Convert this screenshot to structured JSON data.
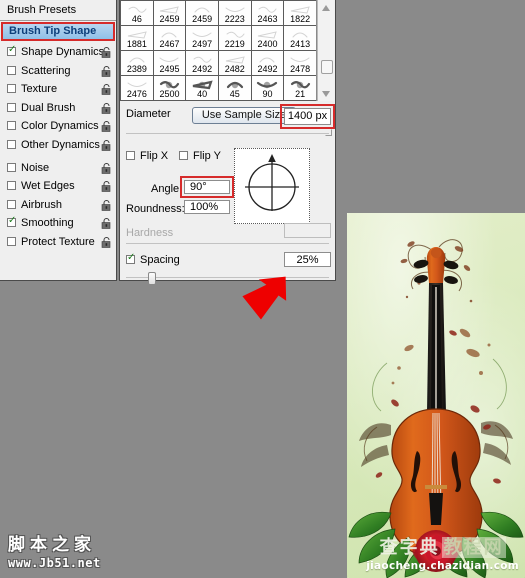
{
  "left_panel": {
    "header": "Brush Presets",
    "selected_item": "Brush Tip Shape",
    "items": [
      {
        "label": "Shape Dynamics",
        "checked": true,
        "locked": true,
        "gap": false
      },
      {
        "label": "Scattering",
        "checked": false,
        "locked": true,
        "gap": false
      },
      {
        "label": "Texture",
        "checked": false,
        "locked": true,
        "gap": false
      },
      {
        "label": "Dual Brush",
        "checked": false,
        "locked": true,
        "gap": false
      },
      {
        "label": "Color Dynamics",
        "checked": false,
        "locked": true,
        "gap": false
      },
      {
        "label": "Other Dynamics",
        "checked": false,
        "locked": true,
        "gap": false
      },
      {
        "label": "Noise",
        "checked": false,
        "locked": true,
        "gap": true
      },
      {
        "label": "Wet Edges",
        "checked": false,
        "locked": true,
        "gap": false
      },
      {
        "label": "Airbrush",
        "checked": false,
        "locked": true,
        "gap": false
      },
      {
        "label": "Smoothing",
        "checked": true,
        "locked": true,
        "gap": false
      },
      {
        "label": "Protect Texture",
        "checked": false,
        "locked": true,
        "gap": false
      }
    ]
  },
  "brush_grid": {
    "rows": [
      [
        "46",
        "2459",
        "2459",
        "2223",
        "2463",
        "1822"
      ],
      [
        "1881",
        "2467",
        "2497",
        "2219",
        "2400",
        "2413"
      ],
      [
        "2389",
        "2495",
        "2492",
        "2482",
        "2492",
        "2478"
      ],
      [
        "2476",
        "2500",
        "40",
        "45",
        "90",
        "21"
      ]
    ]
  },
  "tip_shape": {
    "diameter_label": "Diameter",
    "use_sample_size": "Use Sample Size",
    "diameter_value": "1400 px",
    "flip_x_label": "Flip X",
    "flip_y_label": "Flip Y",
    "flip_x_checked": false,
    "flip_y_checked": false,
    "angle_label": "Angle:",
    "angle_value": "90°",
    "roundness_label": "Roundness:",
    "roundness_value": "100%",
    "hardness_label": "Hardness",
    "hardness_value": "",
    "hardness_disabled": true,
    "spacing_label": "Spacing",
    "spacing_value": "25%",
    "spacing_checked": true
  },
  "annotation": {
    "arrow_color": "#ee0000",
    "highlight_color": "#d62b2b"
  },
  "watermark_left": {
    "cn": "脚本之家",
    "url": "www.Jb51.net"
  },
  "watermark_right": {
    "cn1": "查字典",
    "cn2": "教程网",
    "url": "jiaocheng.chazidian.com"
  },
  "artwork": {
    "title": "violin-with-roses-artwork"
  }
}
